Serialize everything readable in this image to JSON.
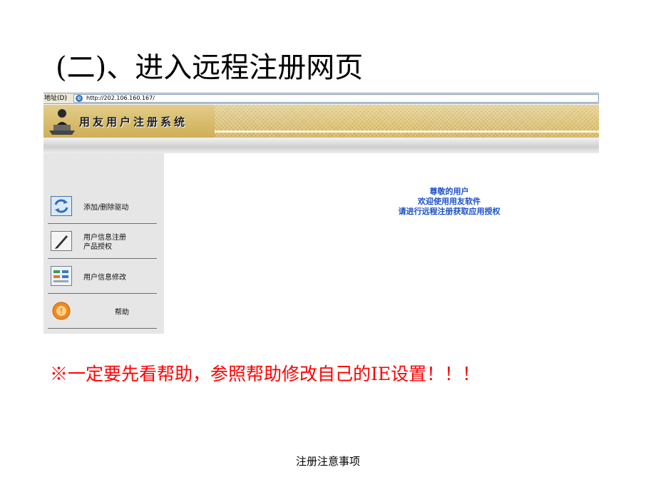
{
  "slide": {
    "title": "(二)、进入远程注册网页",
    "warning": "※一定要先看帮助，参照帮助修改自己的IE设置！！！",
    "footer": "注册注意事项"
  },
  "browser": {
    "address_label": "地址(D)",
    "url": "http://202.106.160.167/",
    "ie_icon": "ie-globe-icon"
  },
  "site": {
    "title": "用友用户注册系统",
    "menu": [
      {
        "label": "添加/删除驱动",
        "icon": "refresh-arrows-icon"
      },
      {
        "label": "用户信息注册\n产品授权",
        "icon": "pen-edit-icon"
      },
      {
        "label": "用户信息修改",
        "icon": "form-grid-icon"
      },
      {
        "label": "帮助",
        "icon": "help-badge-icon"
      }
    ],
    "welcome": [
      "尊敬的用户",
      "欢迎使用用友软件",
      "请进行远程注册获取应用授权"
    ]
  },
  "colors": {
    "warning": "#ff0000",
    "welcome": "#1a50c8",
    "banner": "#d8bc6c"
  }
}
